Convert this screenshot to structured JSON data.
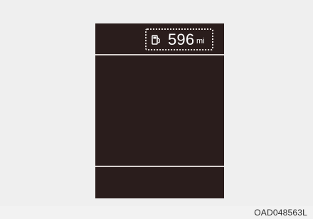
{
  "display": {
    "range_value": "596",
    "range_unit": "mi",
    "icon": "fuel-pump-icon"
  },
  "footer": {
    "figure_code": "OAD048563L"
  },
  "colors": {
    "background": "#efefef",
    "screen": "#2a1d1c",
    "text": "#ffffff",
    "accent": "#d8d2cf"
  }
}
